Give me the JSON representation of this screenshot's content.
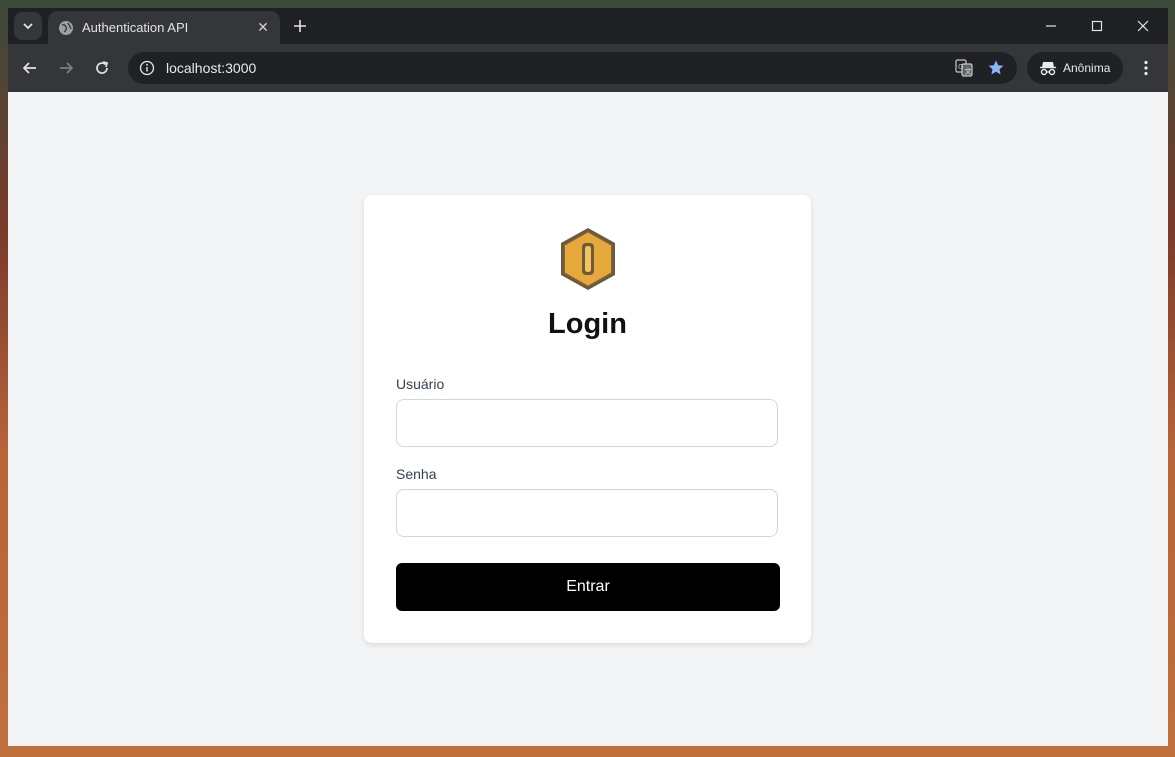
{
  "browser": {
    "tab_title": "Authentication API",
    "url": "localhost:3000",
    "profile_label": "Anônima",
    "icons": {
      "tab_search": "chevron-down-icon",
      "favicon": "globe-icon",
      "tab_close": "close-icon",
      "new_tab": "plus-icon",
      "minimize": "minimize-icon",
      "maximize": "maximize-icon",
      "close": "close-icon",
      "back": "back-arrow-icon",
      "forward": "forward-arrow-icon",
      "reload": "reload-icon",
      "site_info": "info-icon",
      "translate": "translate-icon",
      "bookmark": "star-icon",
      "incognito": "incognito-icon",
      "menu": "kebab-menu-icon"
    },
    "colors": {
      "star": "#8ab4f8"
    }
  },
  "login": {
    "title": "Login",
    "username_label": "Usuário",
    "username_value": "",
    "password_label": "Senha",
    "password_value": "",
    "submit_label": "Entrar",
    "logo": "hexagon-logo-icon",
    "colors": {
      "logo_fill": "#e8a93c",
      "button": "#000000",
      "background": "#f3f4f6"
    }
  }
}
